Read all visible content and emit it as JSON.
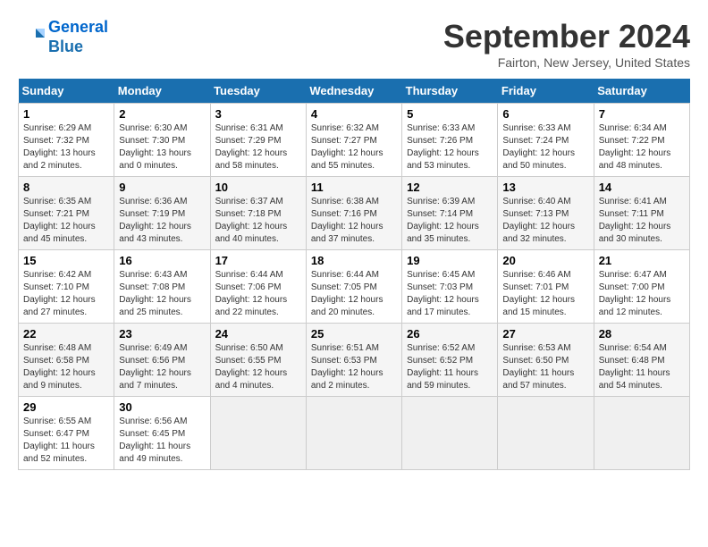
{
  "header": {
    "logo_line1": "General",
    "logo_line2": "Blue",
    "title": "September 2024",
    "subtitle": "Fairton, New Jersey, United States"
  },
  "weekdays": [
    "Sunday",
    "Monday",
    "Tuesday",
    "Wednesday",
    "Thursday",
    "Friday",
    "Saturday"
  ],
  "weeks": [
    [
      {
        "day": "1",
        "sunrise": "6:29 AM",
        "sunset": "7:32 PM",
        "daylight": "13 hours and 2 minutes."
      },
      {
        "day": "2",
        "sunrise": "6:30 AM",
        "sunset": "7:30 PM",
        "daylight": "13 hours and 0 minutes."
      },
      {
        "day": "3",
        "sunrise": "6:31 AM",
        "sunset": "7:29 PM",
        "daylight": "12 hours and 58 minutes."
      },
      {
        "day": "4",
        "sunrise": "6:32 AM",
        "sunset": "7:27 PM",
        "daylight": "12 hours and 55 minutes."
      },
      {
        "day": "5",
        "sunrise": "6:33 AM",
        "sunset": "7:26 PM",
        "daylight": "12 hours and 53 minutes."
      },
      {
        "day": "6",
        "sunrise": "6:33 AM",
        "sunset": "7:24 PM",
        "daylight": "12 hours and 50 minutes."
      },
      {
        "day": "7",
        "sunrise": "6:34 AM",
        "sunset": "7:22 PM",
        "daylight": "12 hours and 48 minutes."
      }
    ],
    [
      {
        "day": "8",
        "sunrise": "6:35 AM",
        "sunset": "7:21 PM",
        "daylight": "12 hours and 45 minutes."
      },
      {
        "day": "9",
        "sunrise": "6:36 AM",
        "sunset": "7:19 PM",
        "daylight": "12 hours and 43 minutes."
      },
      {
        "day": "10",
        "sunrise": "6:37 AM",
        "sunset": "7:18 PM",
        "daylight": "12 hours and 40 minutes."
      },
      {
        "day": "11",
        "sunrise": "6:38 AM",
        "sunset": "7:16 PM",
        "daylight": "12 hours and 37 minutes."
      },
      {
        "day": "12",
        "sunrise": "6:39 AM",
        "sunset": "7:14 PM",
        "daylight": "12 hours and 35 minutes."
      },
      {
        "day": "13",
        "sunrise": "6:40 AM",
        "sunset": "7:13 PM",
        "daylight": "12 hours and 32 minutes."
      },
      {
        "day": "14",
        "sunrise": "6:41 AM",
        "sunset": "7:11 PM",
        "daylight": "12 hours and 30 minutes."
      }
    ],
    [
      {
        "day": "15",
        "sunrise": "6:42 AM",
        "sunset": "7:10 PM",
        "daylight": "12 hours and 27 minutes."
      },
      {
        "day": "16",
        "sunrise": "6:43 AM",
        "sunset": "7:08 PM",
        "daylight": "12 hours and 25 minutes."
      },
      {
        "day": "17",
        "sunrise": "6:44 AM",
        "sunset": "7:06 PM",
        "daylight": "12 hours and 22 minutes."
      },
      {
        "day": "18",
        "sunrise": "6:44 AM",
        "sunset": "7:05 PM",
        "daylight": "12 hours and 20 minutes."
      },
      {
        "day": "19",
        "sunrise": "6:45 AM",
        "sunset": "7:03 PM",
        "daylight": "12 hours and 17 minutes."
      },
      {
        "day": "20",
        "sunrise": "6:46 AM",
        "sunset": "7:01 PM",
        "daylight": "12 hours and 15 minutes."
      },
      {
        "day": "21",
        "sunrise": "6:47 AM",
        "sunset": "7:00 PM",
        "daylight": "12 hours and 12 minutes."
      }
    ],
    [
      {
        "day": "22",
        "sunrise": "6:48 AM",
        "sunset": "6:58 PM",
        "daylight": "12 hours and 9 minutes."
      },
      {
        "day": "23",
        "sunrise": "6:49 AM",
        "sunset": "6:56 PM",
        "daylight": "12 hours and 7 minutes."
      },
      {
        "day": "24",
        "sunrise": "6:50 AM",
        "sunset": "6:55 PM",
        "daylight": "12 hours and 4 minutes."
      },
      {
        "day": "25",
        "sunrise": "6:51 AM",
        "sunset": "6:53 PM",
        "daylight": "12 hours and 2 minutes."
      },
      {
        "day": "26",
        "sunrise": "6:52 AM",
        "sunset": "6:52 PM",
        "daylight": "11 hours and 59 minutes."
      },
      {
        "day": "27",
        "sunrise": "6:53 AM",
        "sunset": "6:50 PM",
        "daylight": "11 hours and 57 minutes."
      },
      {
        "day": "28",
        "sunrise": "6:54 AM",
        "sunset": "6:48 PM",
        "daylight": "11 hours and 54 minutes."
      }
    ],
    [
      {
        "day": "29",
        "sunrise": "6:55 AM",
        "sunset": "6:47 PM",
        "daylight": "11 hours and 52 minutes."
      },
      {
        "day": "30",
        "sunrise": "6:56 AM",
        "sunset": "6:45 PM",
        "daylight": "11 hours and 49 minutes."
      },
      null,
      null,
      null,
      null,
      null
    ]
  ]
}
